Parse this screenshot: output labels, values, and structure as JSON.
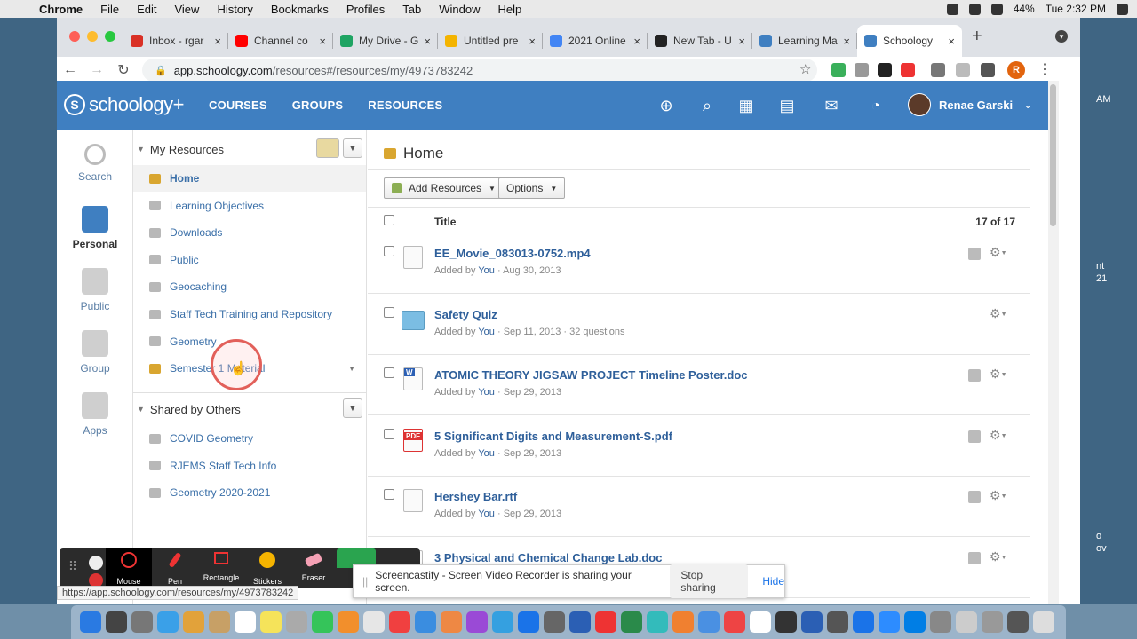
{
  "menubar": {
    "app": "Chrome",
    "items": [
      "File",
      "Edit",
      "View",
      "History",
      "Bookmarks",
      "Profiles",
      "Tab",
      "Window",
      "Help"
    ],
    "battery": "44%",
    "clock": "Tue 2:32 PM"
  },
  "tabs": [
    {
      "title": "Inbox - rgar",
      "color": "#d93025"
    },
    {
      "title": "Channel co",
      "color": "#ff0000"
    },
    {
      "title": "My Drive - G",
      "color": "#1fa463"
    },
    {
      "title": "Untitled pre",
      "color": "#f4b400"
    },
    {
      "title": "2021 Online",
      "color": "#4285f4"
    },
    {
      "title": "New Tab - U",
      "color": "#222222"
    },
    {
      "title": "Learning Ma",
      "color": "#3f7fc1"
    },
    {
      "title": "Schoology",
      "color": "#3f7fc1",
      "active": true
    }
  ],
  "toolbar": {
    "url_host": "app.schoology.com",
    "url_path": "/resources#/resources/my/4973783242",
    "profile_initial": "R"
  },
  "header": {
    "logo": "schoology+",
    "logo_mark": "S",
    "nav": [
      "COURSES",
      "GROUPS",
      "RESOURCES"
    ],
    "user_name": "Renae Garski"
  },
  "rail": [
    {
      "label": "Search",
      "active": false
    },
    {
      "label": "Personal",
      "active": true
    },
    {
      "label": "Public",
      "active": false
    },
    {
      "label": "Group",
      "active": false
    },
    {
      "label": "Apps",
      "active": false
    }
  ],
  "panel": {
    "my_resources_title": "My Resources",
    "my_folders": [
      "Home",
      "Learning Objectives",
      "Downloads",
      "Public",
      "Geocaching",
      "Staff Tech Training and Repository",
      "Geometry",
      "Semester 1 Material"
    ],
    "shared_title": "Shared by Others",
    "shared_folders": [
      "COVID Geometry",
      "RJEMS Staff Tech Info",
      "Geometry 2020-2021"
    ]
  },
  "main": {
    "title": "Home",
    "add_resources": "Add Resources",
    "options": "Options",
    "column_title": "Title",
    "count": "17 of 17",
    "rows": [
      {
        "name": "EE_Movie_083013-0752.mp4",
        "added_by": "Added by",
        "you": "You",
        "date": "· Aug 30, 2013",
        "extra": "",
        "icon": "video"
      },
      {
        "name": "Safety Quiz",
        "added_by": "Added by",
        "you": "You",
        "date": "· Sep 11, 2013",
        "extra": "· 32 questions",
        "icon": "quiz"
      },
      {
        "name": "ATOMIC THEORY JIGSAW PROJECT Timeline Poster.doc",
        "added_by": "Added by",
        "you": "You",
        "date": "· Sep 29, 2013",
        "extra": "",
        "icon": "doc"
      },
      {
        "name": "5 Significant Digits and Measurement-S.pdf",
        "added_by": "Added by",
        "you": "You",
        "date": "· Sep 29, 2013",
        "extra": "",
        "icon": "pdf"
      },
      {
        "name": "Hershey Bar.rtf",
        "added_by": "Added by",
        "you": "You",
        "date": "· Sep 29, 2013",
        "extra": "",
        "icon": "file"
      },
      {
        "name": "3 Physical and Chemical Change Lab.doc",
        "added_by": "",
        "you": "",
        "date": "",
        "extra": "",
        "icon": "doc"
      }
    ]
  },
  "screencastify": {
    "tools": [
      "Mouse",
      "Pen",
      "Rectangle",
      "Stickers",
      "Eraser"
    ],
    "message": "Screencastify - Screen Video Recorder is sharing your screen.",
    "stop": "Stop sharing",
    "hide": "Hide"
  },
  "status_url": "https://app.schoology.com/resources/my/4973783242",
  "desktop_fragments": [
    "AM",
    "nt",
    "21",
    "o",
    "ov"
  ]
}
